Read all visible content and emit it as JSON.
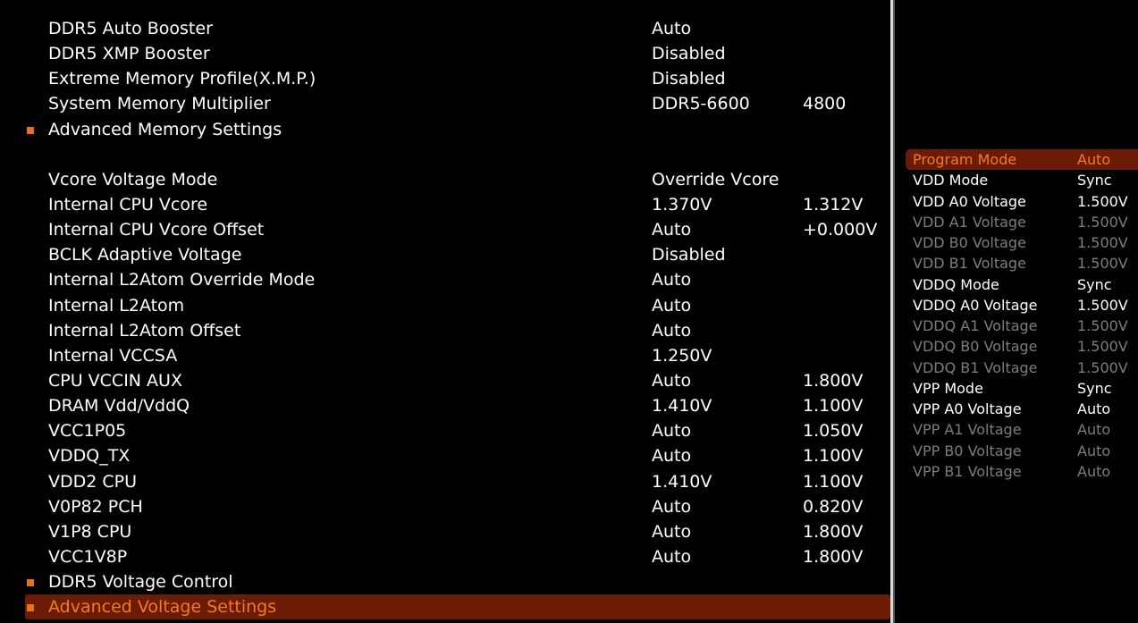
{
  "main": {
    "rows": [
      {
        "kind": "item",
        "label": "DDR5 Auto Booster",
        "v1": "Auto",
        "v2": ""
      },
      {
        "kind": "item",
        "label": "DDR5 XMP Booster",
        "v1": "Disabled",
        "v2": ""
      },
      {
        "kind": "item",
        "label": "Extreme Memory Profile(X.M.P.)",
        "v1": "Disabled",
        "v2": ""
      },
      {
        "kind": "item",
        "label": "System Memory Multiplier",
        "v1": "DDR5-6600",
        "v2": "4800"
      },
      {
        "kind": "submenu",
        "label": "Advanced Memory Settings",
        "v1": "",
        "v2": ""
      },
      {
        "kind": "spacer",
        "label": "",
        "v1": "",
        "v2": ""
      },
      {
        "kind": "item",
        "label": "Vcore Voltage Mode",
        "v1": "Override Vcore",
        "v2": ""
      },
      {
        "kind": "item",
        "label": "Internal CPU Vcore",
        "v1": "1.370V",
        "v2": "1.312V"
      },
      {
        "kind": "item",
        "label": "Internal CPU Vcore Offset",
        "v1": "Auto",
        "v2": "+0.000V"
      },
      {
        "kind": "item",
        "label": "BCLK Adaptive Voltage",
        "v1": "Disabled",
        "v2": ""
      },
      {
        "kind": "item",
        "label": "Internal L2Atom Override Mode",
        "v1": "Auto",
        "v2": ""
      },
      {
        "kind": "item",
        "label": "Internal L2Atom",
        "v1": "Auto",
        "v2": ""
      },
      {
        "kind": "item",
        "label": "Internal L2Atom Offset",
        "v1": "Auto",
        "v2": ""
      },
      {
        "kind": "item",
        "label": "Internal VCCSA",
        "v1": "1.250V",
        "v2": ""
      },
      {
        "kind": "item",
        "label": "CPU VCCIN AUX",
        "v1": "Auto",
        "v2": "1.800V"
      },
      {
        "kind": "item",
        "label": "DRAM Vdd/VddQ",
        "v1": "1.410V",
        "v2": "1.100V"
      },
      {
        "kind": "item",
        "label": "VCC1P05",
        "v1": "Auto",
        "v2": "1.050V"
      },
      {
        "kind": "item",
        "label": "VDDQ_TX",
        "v1": "Auto",
        "v2": "1.100V"
      },
      {
        "kind": "item",
        "label": "VDD2 CPU",
        "v1": "1.410V",
        "v2": "1.100V"
      },
      {
        "kind": "item",
        "label": "V0P82 PCH",
        "v1": "Auto",
        "v2": "0.820V"
      },
      {
        "kind": "item",
        "label": "V1P8 CPU",
        "v1": "Auto",
        "v2": "1.800V"
      },
      {
        "kind": "item",
        "label": "VCC1V8P",
        "v1": "Auto",
        "v2": "1.800V"
      },
      {
        "kind": "submenu",
        "label": "DDR5 Voltage Control",
        "v1": "",
        "v2": ""
      },
      {
        "kind": "selected",
        "label": "Advanced Voltage Settings",
        "v1": "",
        "v2": ""
      }
    ]
  },
  "side_panel": {
    "rows": [
      {
        "label": "Program Mode",
        "value": "Auto",
        "state": "active"
      },
      {
        "label": "VDD Mode",
        "value": "Sync",
        "state": "normal"
      },
      {
        "label": "VDD A0 Voltage",
        "value": "1.500V",
        "state": "normal"
      },
      {
        "label": "VDD A1 Voltage",
        "value": "1.500V",
        "state": "dim"
      },
      {
        "label": "VDD B0 Voltage",
        "value": "1.500V",
        "state": "dim"
      },
      {
        "label": "VDD B1 Voltage",
        "value": "1.500V",
        "state": "dim"
      },
      {
        "label": "VDDQ Mode",
        "value": "Sync",
        "state": "normal"
      },
      {
        "label": "VDDQ A0 Voltage",
        "value": "1.500V",
        "state": "normal"
      },
      {
        "label": "VDDQ A1 Voltage",
        "value": "1.500V",
        "state": "dim"
      },
      {
        "label": "VDDQ B0 Voltage",
        "value": "1.500V",
        "state": "dim"
      },
      {
        "label": "VDDQ B1 Voltage",
        "value": "1.500V",
        "state": "dim"
      },
      {
        "label": "VPP Mode",
        "value": "Sync",
        "state": "normal"
      },
      {
        "label": "VPP A0 Voltage",
        "value": "Auto",
        "state": "normal"
      },
      {
        "label": "VPP A1 Voltage",
        "value": "Auto",
        "state": "dim"
      },
      {
        "label": "VPP B0 Voltage",
        "value": "Auto",
        "state": "dim"
      },
      {
        "label": "VPP B1 Voltage",
        "value": "Auto",
        "state": "dim"
      }
    ]
  },
  "colors": {
    "accent": "#f47a22",
    "selection_bg": "#6b1b06",
    "bullet": "#e8701c",
    "dim_text": "#7d7d7d"
  }
}
